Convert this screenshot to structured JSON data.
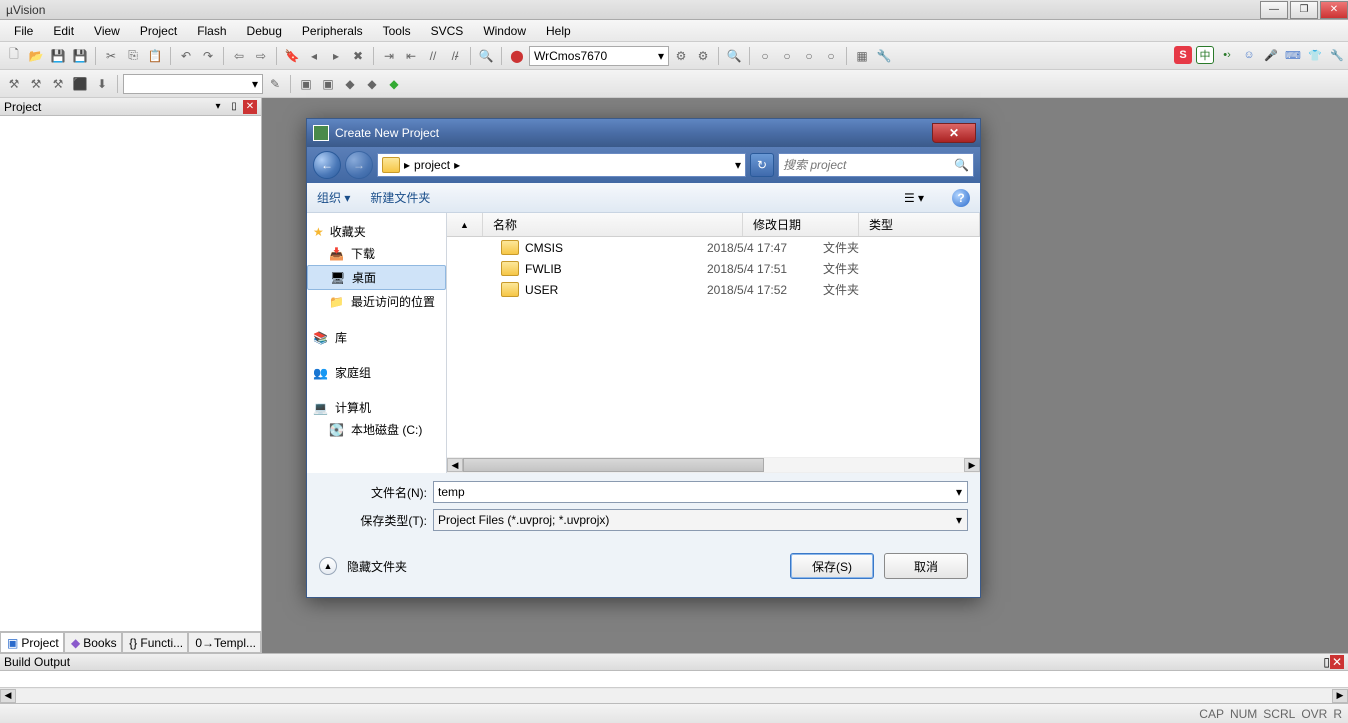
{
  "window": {
    "title": "µVision"
  },
  "menu": [
    "File",
    "Edit",
    "View",
    "Project",
    "Flash",
    "Debug",
    "Peripherals",
    "Tools",
    "SVCS",
    "Window",
    "Help"
  ],
  "toolbar": {
    "target_combo": "WrCmos7670"
  },
  "project_pane": {
    "title": "Project"
  },
  "pane_tabs": [
    "Project",
    "Books",
    "{} Functi...",
    "0→Templ..."
  ],
  "build_output": {
    "title": "Build Output"
  },
  "status": [
    "CAP",
    "NUM",
    "SCRL",
    "OVR",
    "R"
  ],
  "ime": {
    "logo": "S",
    "lang": "中"
  },
  "dialog": {
    "title": "Create New Project",
    "breadcrumb": [
      "▸",
      "project",
      "▸"
    ],
    "search_placeholder": "搜索 project",
    "toolbar": {
      "organize": "组织 ▾",
      "new_folder": "新建文件夹"
    },
    "tree": {
      "favorites": {
        "label": "收藏夹",
        "items": [
          {
            "label": "下载"
          },
          {
            "label": "桌面",
            "selected": true
          },
          {
            "label": "最近访问的位置"
          }
        ]
      },
      "libraries": {
        "label": "库"
      },
      "homegroup": {
        "label": "家庭组"
      },
      "computer": {
        "label": "计算机",
        "items": [
          {
            "label": "本地磁盘 (C:)"
          }
        ]
      }
    },
    "columns": {
      "arrow": "▲",
      "name": "名称",
      "date": "修改日期",
      "type": "类型"
    },
    "rows": [
      {
        "name": "CMSIS",
        "date": "2018/5/4 17:47",
        "type": "文件夹"
      },
      {
        "name": "FWLIB",
        "date": "2018/5/4 17:51",
        "type": "文件夹"
      },
      {
        "name": "USER",
        "date": "2018/5/4 17:52",
        "type": "文件夹"
      }
    ],
    "filename_label": "文件名(N):",
    "filename_value": "temp",
    "filetype_label": "保存类型(T):",
    "filetype_value": "Project Files (*.uvproj; *.uvprojx)",
    "hide_folders": "隐藏文件夹",
    "save": "保存(S)",
    "cancel": "取消"
  }
}
